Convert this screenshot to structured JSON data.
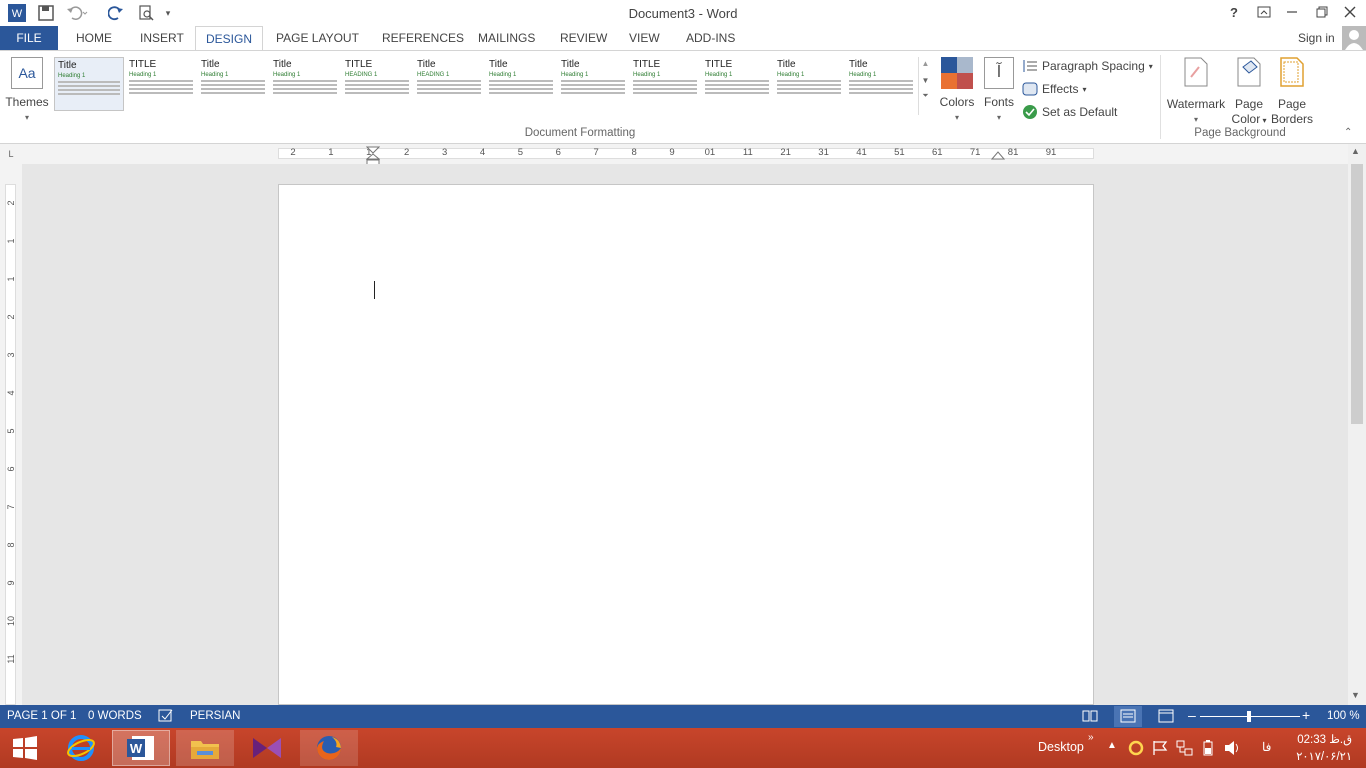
{
  "window": {
    "title": "Document3 - Word"
  },
  "quick_access": {
    "icons": [
      "word-logo-icon",
      "save-icon",
      "undo-icon",
      "redo-icon",
      "print-preview-icon",
      "customize-icon"
    ]
  },
  "window_controls": {
    "help": "?",
    "icons": [
      "help-icon",
      "ribbon-display-icon",
      "minimize-icon",
      "restore-icon",
      "close-icon"
    ]
  },
  "tabs": {
    "file": "FILE",
    "home": "HOME",
    "insert": "INSERT",
    "design": "DESIGN",
    "page_layout": "PAGE LAYOUT",
    "references": "REFERENCES",
    "mailings": "MAILINGS",
    "review": "REVIEW",
    "view": "VIEW",
    "add_ins": "ADD-INS",
    "sign_in": "Sign in"
  },
  "ribbon": {
    "themes": {
      "label": "Themes",
      "icon_text": "Aa"
    },
    "styles_gallery": [
      {
        "title": "Title",
        "heading": "Heading 1"
      },
      {
        "title": "TITLE",
        "heading": "Heading 1"
      },
      {
        "title": "Title",
        "heading": "Heading 1"
      },
      {
        "title": "Title",
        "heading": "Heading 1"
      },
      {
        "title": "TITLE",
        "heading": "HEADING 1"
      },
      {
        "title": "Title",
        "heading": "HEADING 1"
      },
      {
        "title": "Title",
        "heading": "Heading 1"
      },
      {
        "title": "Title",
        "heading": "Heading 1"
      },
      {
        "title": "TITLE",
        "heading": "Heading 1"
      },
      {
        "title": "TITLE",
        "heading": "Heading 1"
      },
      {
        "title": "Title",
        "heading": "Heading 1"
      },
      {
        "title": "Title",
        "heading": "Heading 1"
      }
    ],
    "document_formatting": "Document Formatting",
    "colors": "Colors",
    "fonts": "Fonts",
    "fonts_icon_text": "آ",
    "paragraph_spacing": "Paragraph Spacing",
    "effects": "Effects",
    "set_as_default": "Set as Default",
    "watermark": "Watermark",
    "page_color": [
      "Page",
      "Color"
    ],
    "page_borders": [
      "Page",
      "Borders"
    ],
    "page_background": "Page Background",
    "theme_colors": [
      "#2b579a",
      "#a9b8cc",
      "#e97132",
      "#c0504d"
    ]
  },
  "ruler": {
    "horizontal": [
      "2",
      "1",
      "1",
      "2",
      "3",
      "4",
      "5",
      "6",
      "7",
      "8",
      "9",
      "01",
      "11",
      "21",
      "31",
      "41",
      "51",
      "61",
      "71",
      "81",
      "91"
    ],
    "vertical": [
      "2",
      "1",
      "1",
      "2",
      "3",
      "4",
      "5",
      "6",
      "7",
      "8",
      "9",
      "10",
      "11"
    ],
    "tab_selector": "L"
  },
  "status": {
    "page": "PAGE 1 OF 1",
    "words": "0 WORDS",
    "language": "PERSIAN",
    "zoom": "100 %"
  },
  "taskbar": {
    "desktop": "Desktop",
    "time": "02:33 ق.ظ",
    "date": "۲۰۱۷/۰۶/۲۱",
    "lang": "فا"
  },
  "colors": {
    "accent": "#2b579a",
    "taskbar": "#c0422a",
    "design_tab": "#2b579a"
  }
}
